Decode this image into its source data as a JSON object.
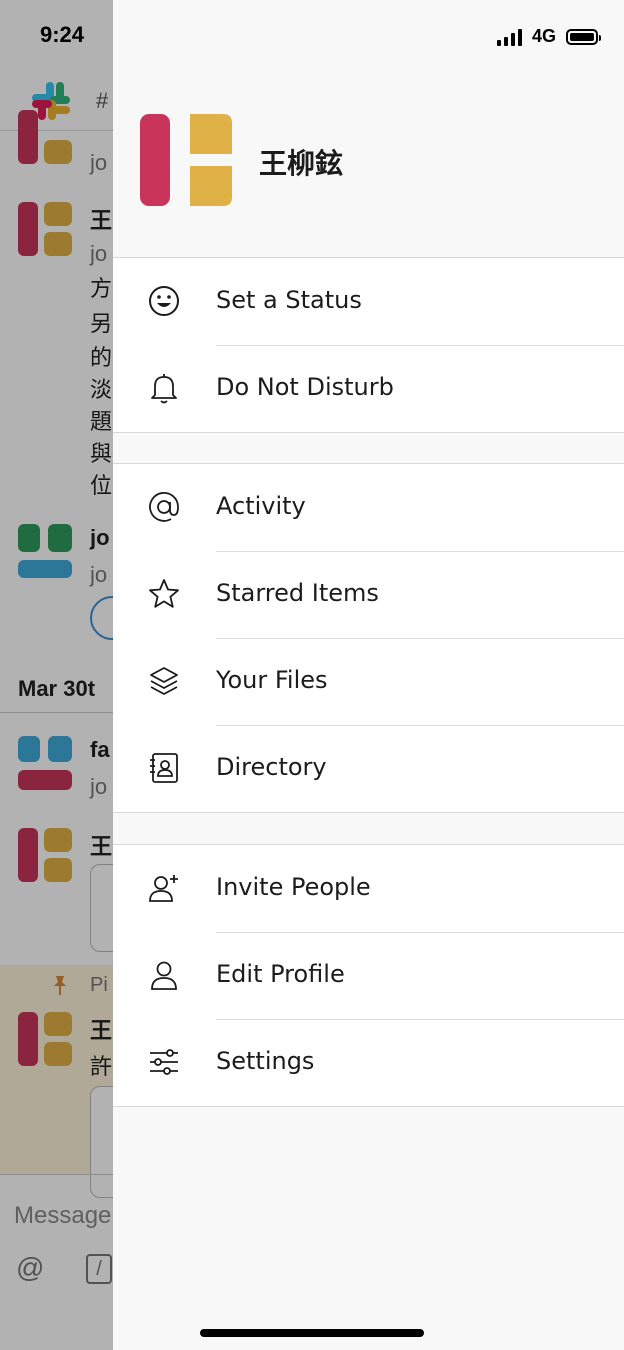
{
  "status_bar": {
    "time": "9:24",
    "network": "4G"
  },
  "background": {
    "channel_hash": "#",
    "date_divider": "Mar 30t",
    "pinned_label": "Pi",
    "composer_placeholder": "Message",
    "composer_at": "@",
    "composer_slash": "/",
    "messages": [
      {
        "name": "",
        "line": "jo"
      },
      {
        "name": "王",
        "line": "jo",
        "extra": [
          "方",
          "另",
          "的",
          "淡",
          "題",
          "與",
          "位"
        ]
      },
      {
        "name": "jo",
        "line": "jo"
      },
      {
        "name": "fa",
        "line": "jo"
      },
      {
        "name": "王",
        "line": ""
      },
      {
        "name": "王",
        "line": "許"
      }
    ]
  },
  "profile": {
    "name": "王柳鉉"
  },
  "menu": {
    "group1": [
      {
        "label": "Set a Status",
        "icon": "smiley-icon"
      },
      {
        "label": "Do Not Disturb",
        "icon": "bell-icon"
      }
    ],
    "group2": [
      {
        "label": "Activity",
        "icon": "at-sign-icon"
      },
      {
        "label": "Starred Items",
        "icon": "star-icon"
      },
      {
        "label": "Your Files",
        "icon": "layers-icon"
      },
      {
        "label": "Directory",
        "icon": "contact-card-icon"
      }
    ],
    "group3": [
      {
        "label": "Invite People",
        "icon": "add-person-icon"
      },
      {
        "label": "Edit Profile",
        "icon": "person-icon"
      },
      {
        "label": "Settings",
        "icon": "sliders-icon"
      }
    ]
  },
  "colors": {
    "avatar_red": "#c8345a",
    "avatar_gold": "#e0b146",
    "avatar_green": "#2e9a5c",
    "avatar_blue": "#3fa9d8",
    "drawer_bg": "#f8f8f8",
    "text": "#1d1c1d"
  }
}
